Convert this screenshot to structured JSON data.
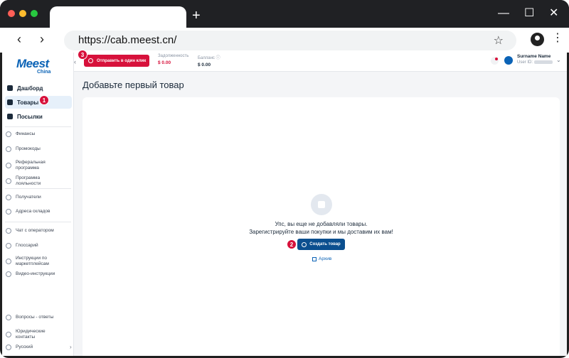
{
  "browser": {
    "url": "https://cab.meest.cn/",
    "new_tab": "+",
    "back": "‹",
    "forward": "›",
    "bookmark": "☆",
    "menu": "⋮",
    "window_controls": {
      "minimize": "—",
      "maximize": "☐",
      "close": "✕"
    }
  },
  "logo": {
    "main": "Meest",
    "sub": "China"
  },
  "sidebar": {
    "main": [
      {
        "label": "Дашборд"
      },
      {
        "label": "Товары"
      },
      {
        "label": "Посылки"
      }
    ],
    "group1": [
      {
        "label": "Финансы"
      },
      {
        "label": "Промокоды"
      },
      {
        "label": "Реферальная программа"
      },
      {
        "label": "Программа лояльности"
      }
    ],
    "group2": [
      {
        "label": "Получатели"
      },
      {
        "label": "Адреса складов"
      }
    ],
    "group3": [
      {
        "label": "Чат с оператором"
      },
      {
        "label": "Глоссарий"
      },
      {
        "label": "Инструкции по маркетплейсам"
      },
      {
        "label": "Видео-инструкции"
      }
    ],
    "bottom": [
      {
        "label": "Вопросы - ответы"
      },
      {
        "label": "Юридические контакты"
      },
      {
        "label": "Русский",
        "chevron": "›"
      }
    ]
  },
  "topbar": {
    "collapse": "‹",
    "one_click_label": "Отправить в один клик",
    "debt_label": "Задолженность",
    "debt_value": "$ 0.00",
    "balance_label": "Балланс ⓘ",
    "balance_value": "$ 0.00",
    "user_name": "Surname Name",
    "user_id_label": "User ID:",
    "chevron": "⌄"
  },
  "main": {
    "title": "Добавьте первый товар",
    "empty_line1": "Упс, вы еще не добавляли товары.",
    "empty_line2": "Зарегистрируйте ваши покупки и мы доставим их вам!",
    "create_button": "Создать товар",
    "archive_link": "Архив"
  },
  "annotations": {
    "badge1": "1",
    "badge2": "2",
    "badge3": "3"
  },
  "colors": {
    "brand_blue": "#0b63b6",
    "accent_red": "#d7113b",
    "button_blue": "#0b4f8f"
  }
}
